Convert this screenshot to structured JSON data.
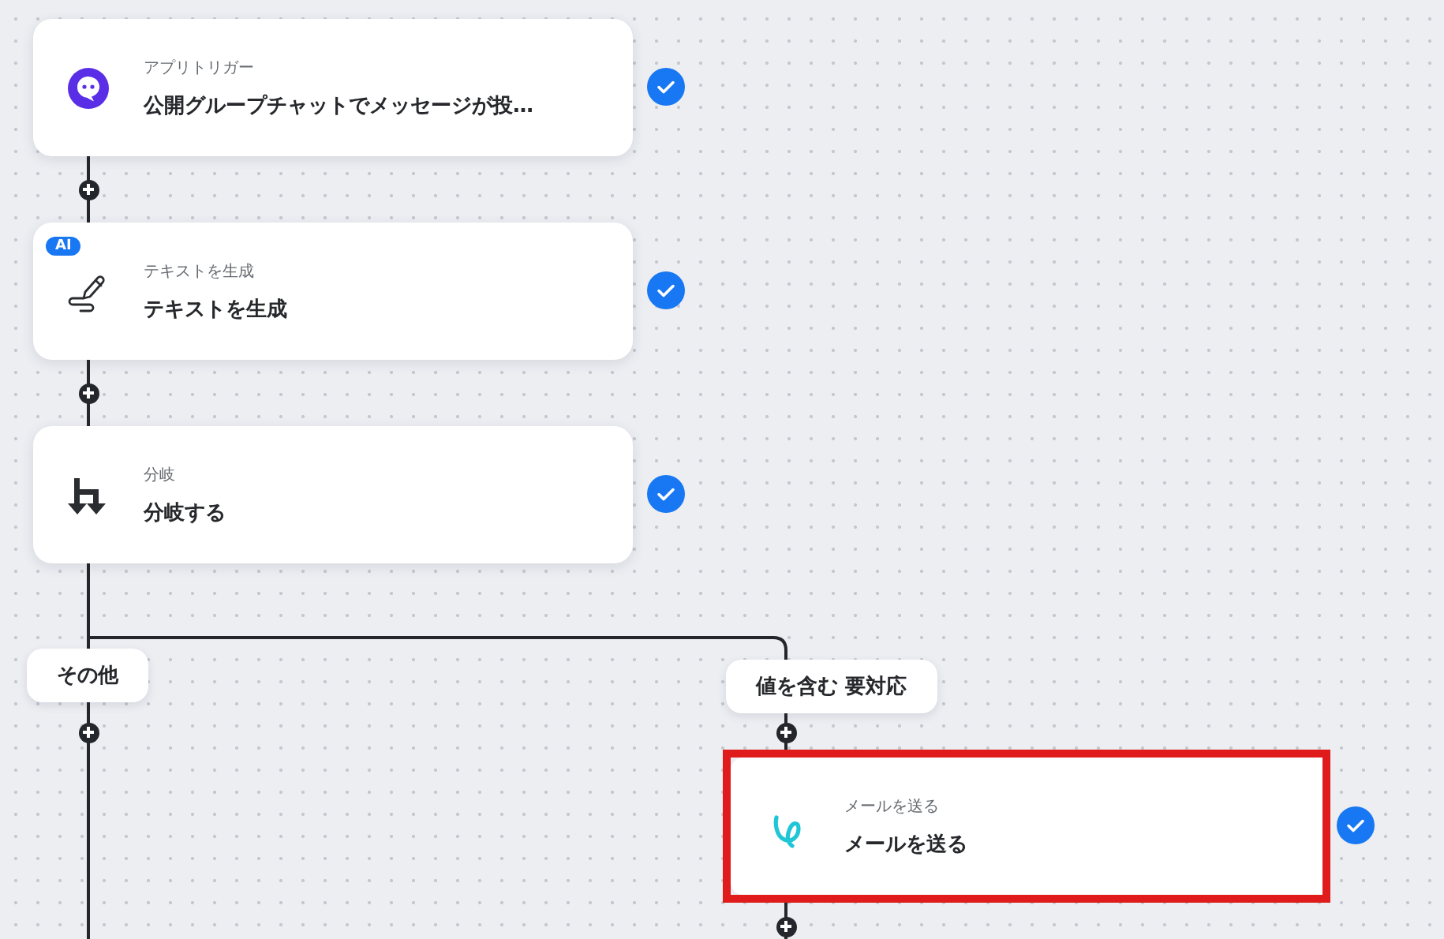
{
  "steps": [
    {
      "kind": "chat",
      "category": "アプリトリガー",
      "title": "公開グループチャットでメッセージが投…",
      "done": true,
      "highlighted": false
    },
    {
      "kind": "ai-text",
      "badge": "AI",
      "category": "テキストを生成",
      "title": "テキストを生成",
      "done": true,
      "highlighted": false
    },
    {
      "kind": "branch",
      "category": "分岐",
      "title": "分岐する",
      "done": true,
      "highlighted": false
    }
  ],
  "branches": [
    {
      "label": "その他"
    },
    {
      "label": "値を含む 要対応",
      "steps": [
        {
          "kind": "mail",
          "category": "メールを送る",
          "title": "メールを送る",
          "done": true,
          "highlighted": true
        }
      ]
    }
  ]
}
